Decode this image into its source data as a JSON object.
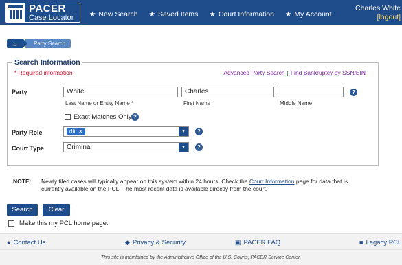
{
  "header": {
    "logo_title": "PACER",
    "logo_sub": "Case Locator",
    "nav": [
      {
        "label": "New Search"
      },
      {
        "label": "Saved Items"
      },
      {
        "label": "Court Information"
      },
      {
        "label": "My Account"
      }
    ],
    "user_name": "Charles White",
    "logout": "[logout]"
  },
  "breadcrumb": {
    "home_icon": "⌂",
    "page": "Party Search"
  },
  "form": {
    "legend": "Search Information",
    "required": "* Required information",
    "link_advanced": "Advanced Party Search",
    "link_separator": "|",
    "link_bankruptcy": "Find Bankruptcy by SSN/EIN",
    "party_label": "Party",
    "last_name_value": "White",
    "last_name_hint": "Last Name or Entity Name *",
    "first_name_value": "Charles",
    "first_name_hint": "First Name",
    "middle_name_value": "",
    "middle_name_hint": "Middle Name",
    "exact_label": "Exact Matches Only",
    "role_label": "Party Role",
    "role_tag": "dft",
    "role_tag_remove": "×",
    "court_label": "Court Type",
    "court_value": "Criminal",
    "help": "?",
    "dropdown_arrow": "▼"
  },
  "note": {
    "label": "NOTE:",
    "text_before": "Newly filed cases will typically appear on this system within 24 hours. Check the ",
    "link": "Court Information",
    "text_after": " page for data that is currently available on the PCL. The most recent data is available directly from the court."
  },
  "buttons": {
    "search": "Search",
    "clear": "Clear"
  },
  "home_pref": "Make this my PCL home page.",
  "footer": {
    "contact": "Contact Us",
    "privacy": "Privacy & Security",
    "faq": "PACER FAQ",
    "legacy": "Legacy PCL",
    "maintained": "This site is maintained by the Administrative Office of the U.S. Courts, PACER Service Center."
  },
  "colors": {
    "brand": "#1f4d8c",
    "required": "#c8102e",
    "logout": "#ffd34d",
    "visited_link": "#7a1fa0"
  }
}
